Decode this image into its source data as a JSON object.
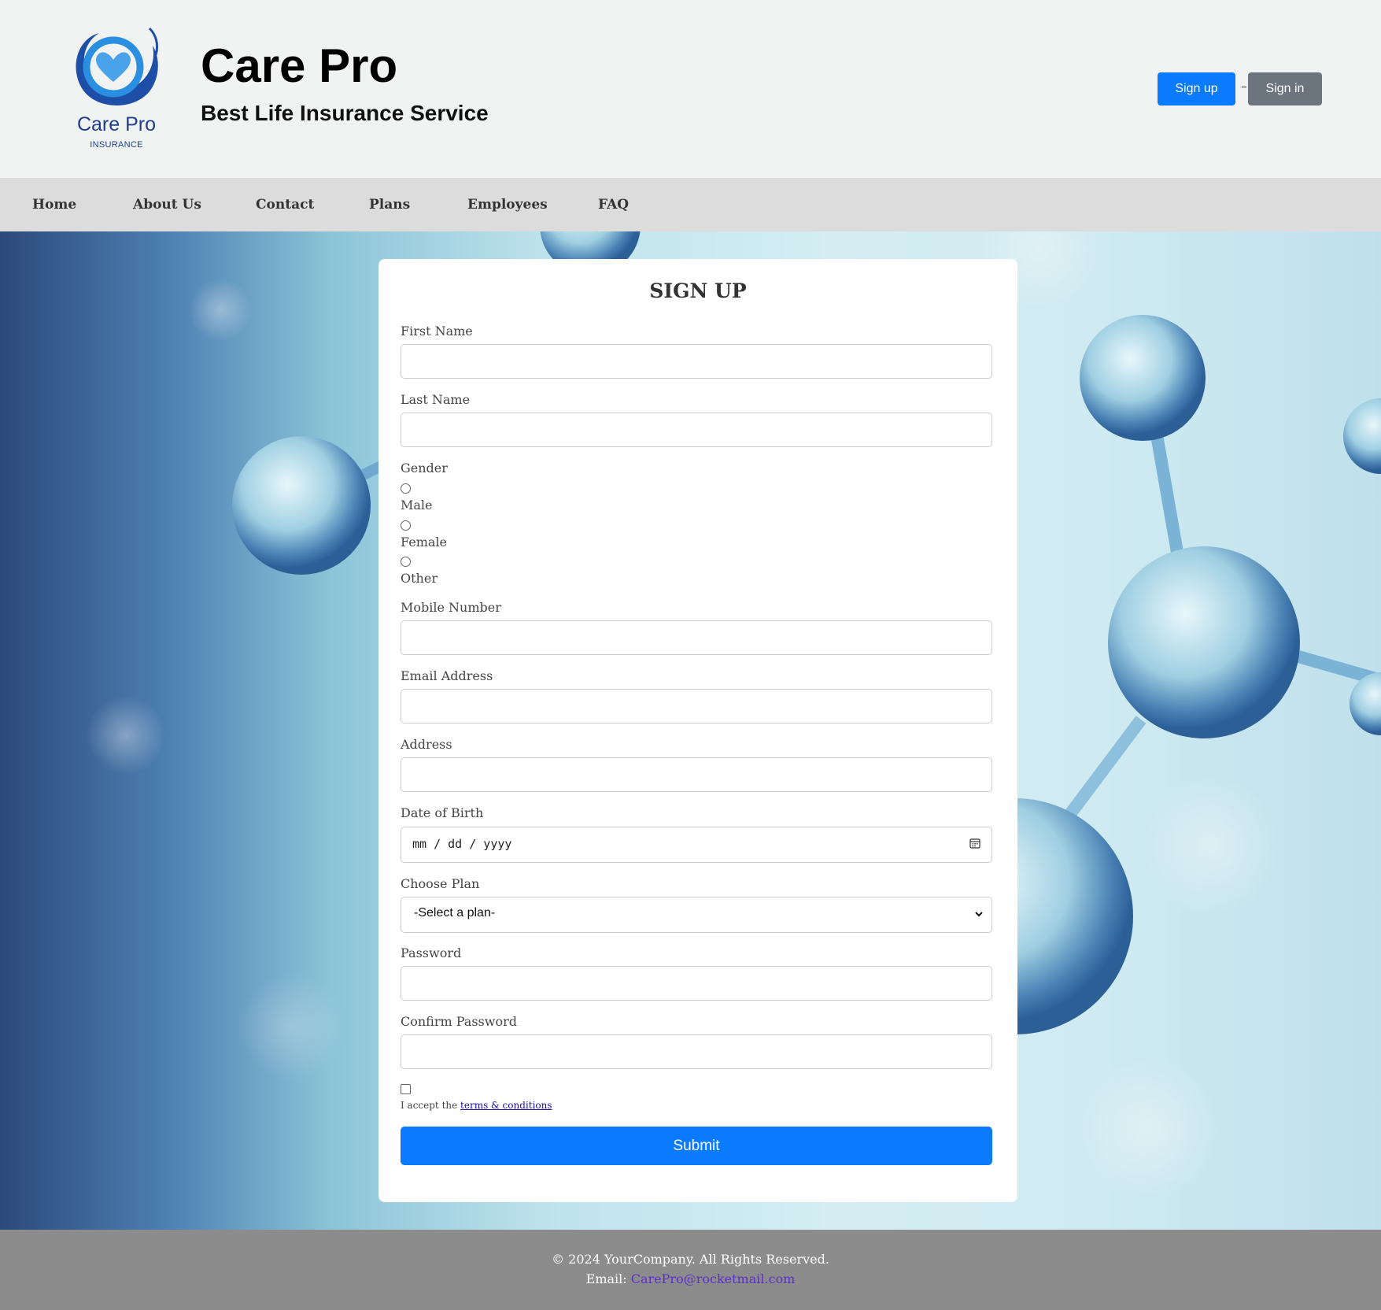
{
  "header": {
    "logo_text": "Care Pro",
    "logo_subtext": "INSURANCE",
    "title": "Care Pro",
    "subtitle": "Best Life Insurance Service",
    "signup_label": "Sign up",
    "signin_label": "Sign in"
  },
  "nav": {
    "items": [
      {
        "label": "Home"
      },
      {
        "label": "About Us"
      },
      {
        "label": "Contact"
      },
      {
        "label": "Plans"
      },
      {
        "label": "Employees"
      },
      {
        "label": "FAQ"
      }
    ]
  },
  "form": {
    "title": "SIGN UP",
    "first_name_label": "First Name",
    "last_name_label": "Last Name",
    "gender_label": "Gender",
    "gender_options": [
      "Male",
      "Female",
      "Other"
    ],
    "mobile_label": "Mobile Number",
    "email_label": "Email Address",
    "address_label": "Address",
    "dob_label": "Date of Birth",
    "dob_placeholder": "mm / dd / yyyy",
    "plan_label": "Choose Plan",
    "plan_selected": "-Select a plan-",
    "password_label": "Password",
    "confirm_password_label": "Confirm Password",
    "terms_prefix": "I accept the ",
    "terms_link": "terms & conditions",
    "submit_label": "Submit"
  },
  "footer": {
    "copyright": "© 2024 YourCompany. All Rights Reserved.",
    "email_prefix": "Email: ",
    "email": "CarePro@rocketmail.com"
  },
  "colors": {
    "primary": "#0a7bff",
    "secondary": "#6c757d",
    "nav_bg": "#dcdcdc",
    "footer_bg": "#8c8c8c",
    "logo_blue": "#1d3f8c"
  }
}
